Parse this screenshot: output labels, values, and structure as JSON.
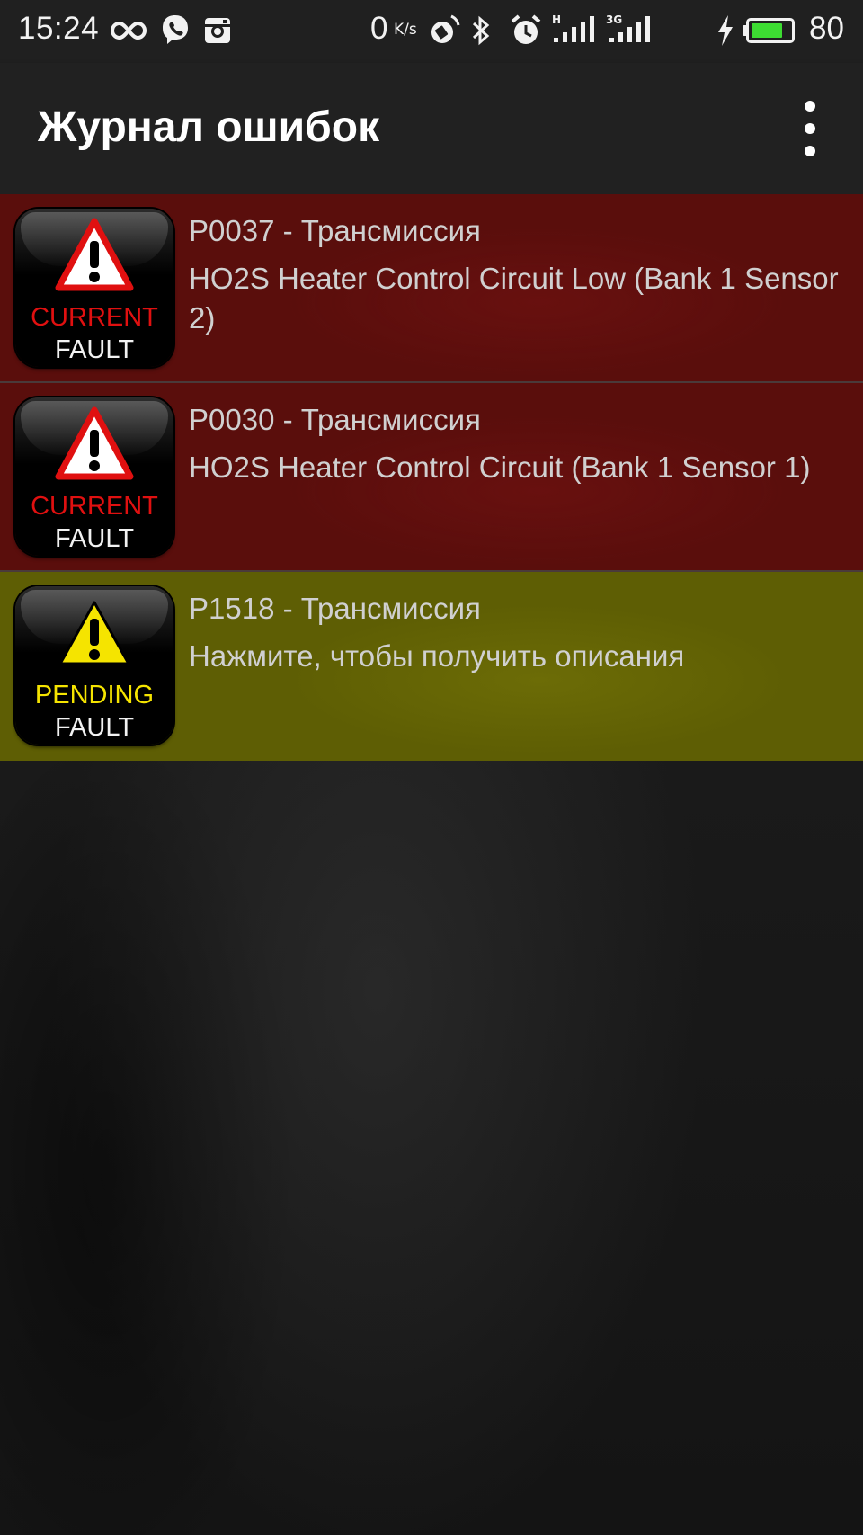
{
  "status_bar": {
    "time": "15:24",
    "net_speed_value": "0",
    "net_speed_unit": "K/s",
    "signal1_label": "H",
    "signal2_label": "3G",
    "battery_level": "80",
    "battery_percent": 80,
    "icons": [
      "infinity-icon",
      "viber-icon",
      "instagram-icon",
      "data-speed-icon",
      "rotation-icon",
      "bluetooth-icon",
      "alarm-icon",
      "signal-icon",
      "signal-icon",
      "charging-icon",
      "battery-icon"
    ]
  },
  "app_bar": {
    "title": "Журнал ошибок",
    "menu_icon": "overflow-menu-icon"
  },
  "colors": {
    "current_row": "#5a0e0c",
    "pending_row": "#5e5e04",
    "current_text": "#e01010",
    "pending_text": "#f5e400",
    "battery_green": "#3ddc32"
  },
  "faults": [
    {
      "title": "P0037 - Трансмиссия",
      "description": "HO2S Heater Control Circuit Low (Bank 1 Sensor 2)",
      "badge_line1": "CURRENT",
      "badge_line2": "FAULT",
      "status": "current",
      "icon": "warning-icon"
    },
    {
      "title": "P0030 - Трансмиссия",
      "description": "HO2S Heater Control Circuit (Bank 1 Sensor 1)",
      "badge_line1": "CURRENT",
      "badge_line2": "FAULT",
      "status": "current",
      "icon": "warning-icon"
    },
    {
      "title": "P1518 - Трансмиссия",
      "description": "Нажмите, чтобы получить описания",
      "badge_line1": "PENDING",
      "badge_line2": "FAULT",
      "status": "pending",
      "icon": "warning-icon"
    }
  ]
}
